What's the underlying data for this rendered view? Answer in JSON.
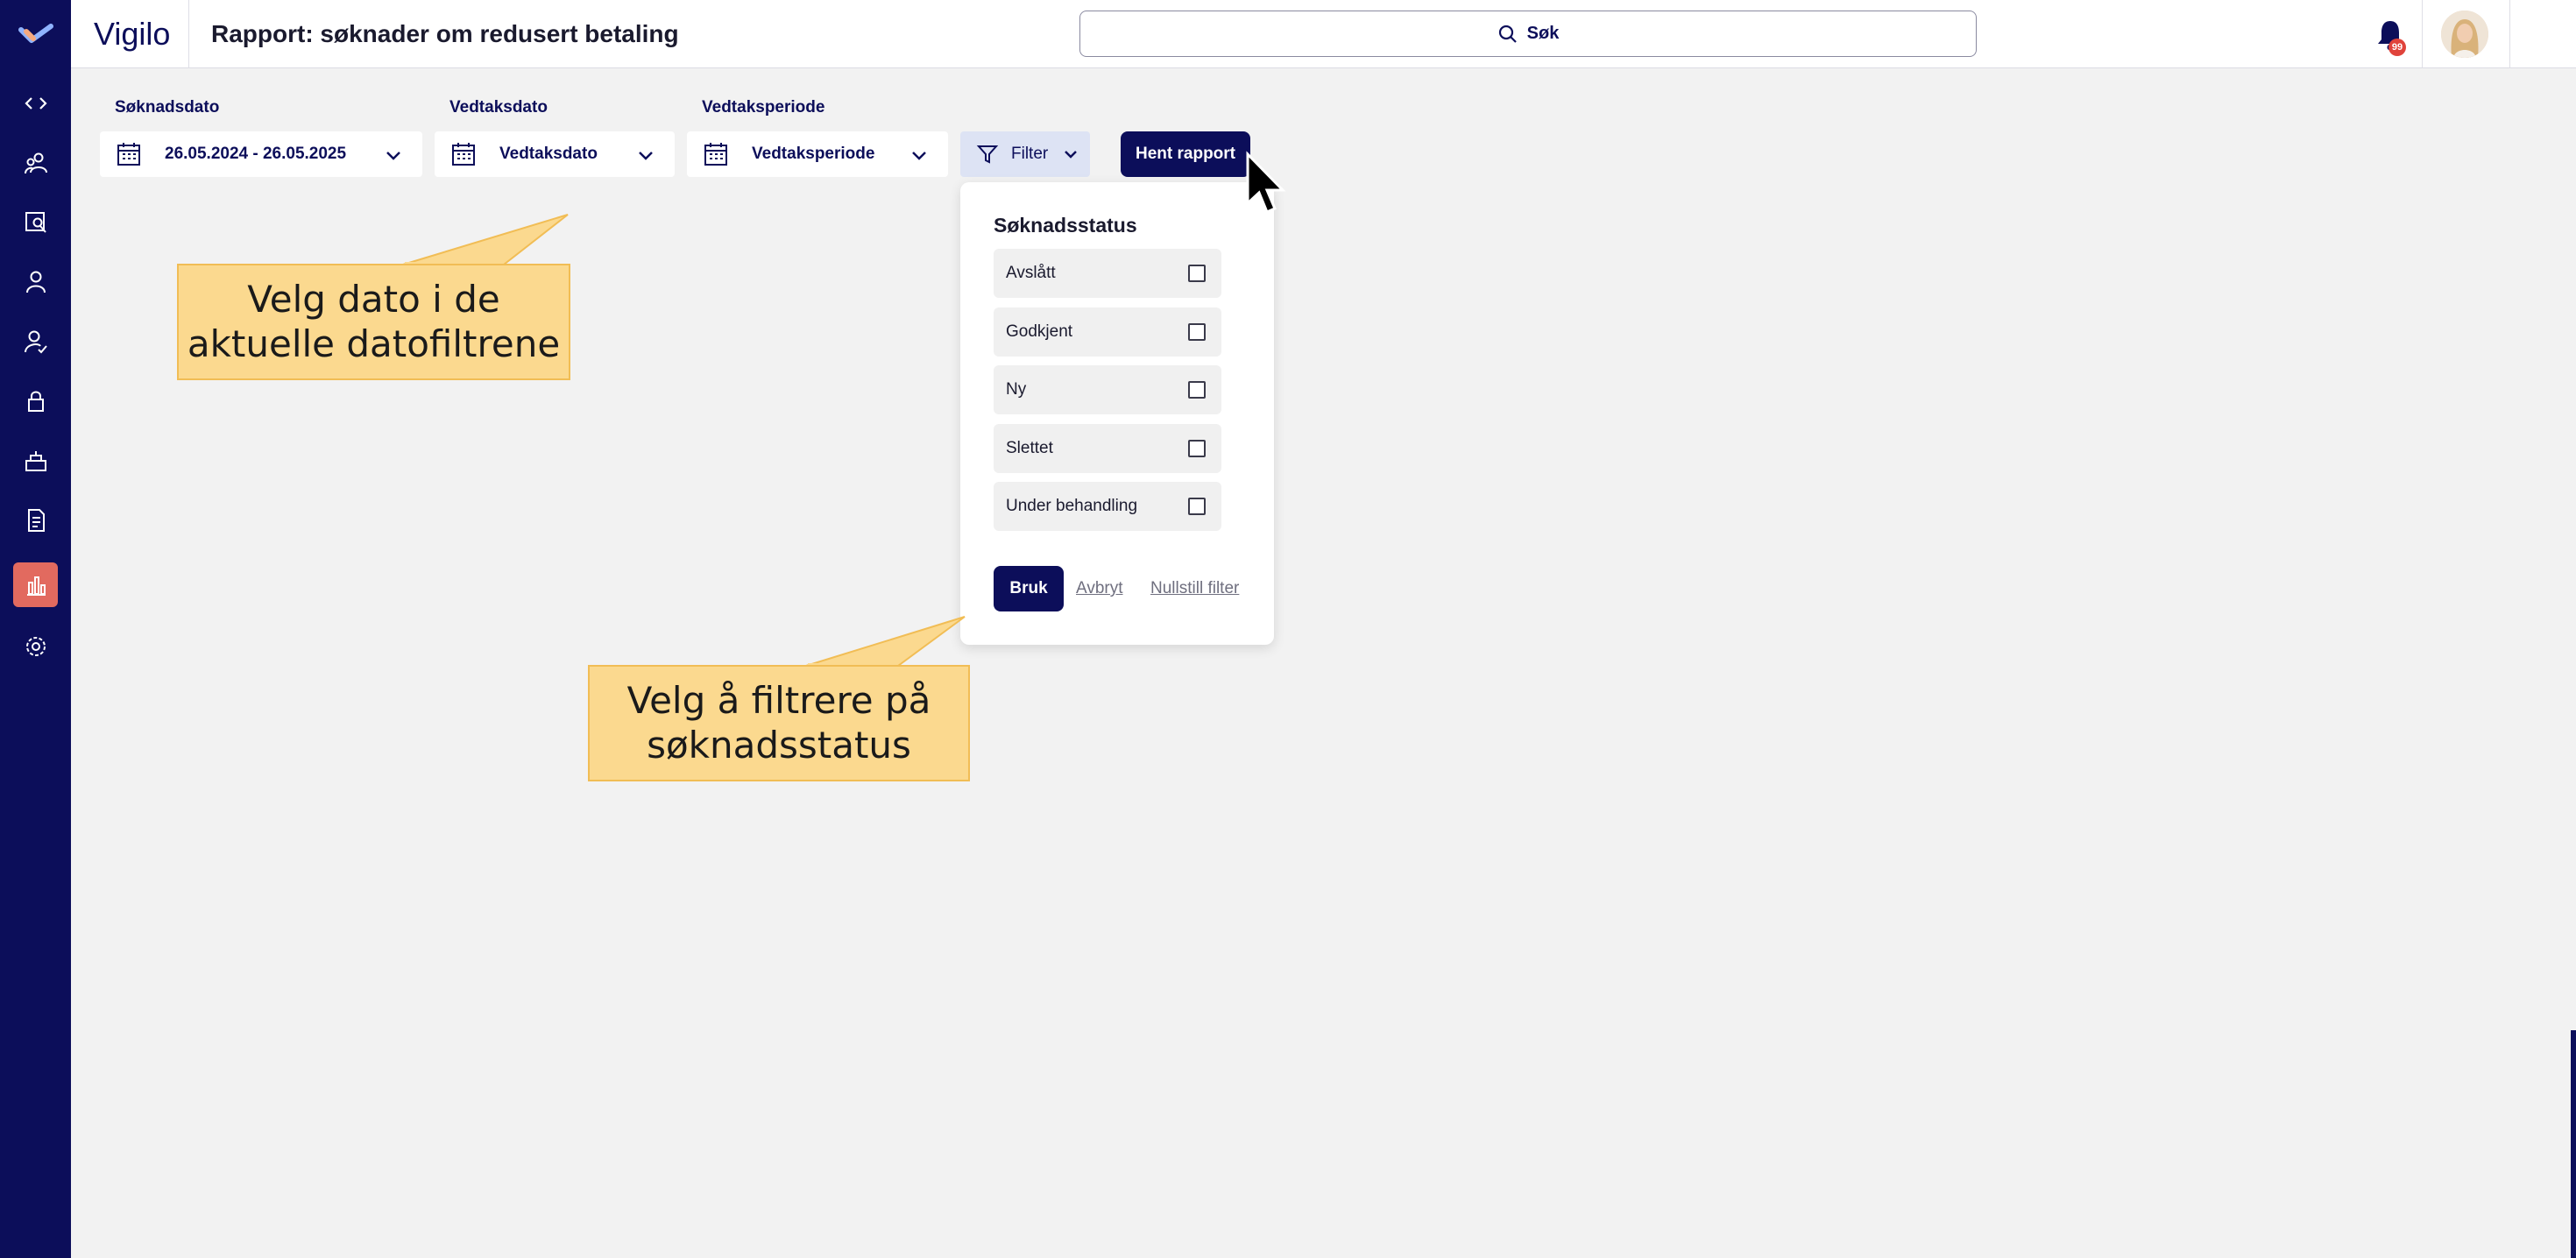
{
  "app": {
    "brand": "Vigilo",
    "title": "Rapport: søknader om redusert betaling"
  },
  "search": {
    "label": "Søk"
  },
  "notifications": {
    "count": "99"
  },
  "sidebar": {
    "items": [
      {
        "icon": "code-icon"
      },
      {
        "icon": "users-icon"
      },
      {
        "icon": "search-person-icon"
      },
      {
        "icon": "person-icon"
      },
      {
        "icon": "person-check-icon"
      },
      {
        "icon": "lock-icon"
      },
      {
        "icon": "cake-icon"
      },
      {
        "icon": "document-icon"
      },
      {
        "icon": "bar-chart-icon",
        "active": true
      },
      {
        "icon": "gear-icon"
      }
    ]
  },
  "filters": {
    "soknadsdato": {
      "label": "Søknadsdato",
      "value": "26.05.2024 - 26.05.2025"
    },
    "vedtaksdato": {
      "label": "Vedtaksdato",
      "value": "Vedtaksdato"
    },
    "vedtaksperiode": {
      "label": "Vedtaksperiode",
      "value": "Vedtaksperiode"
    },
    "filter_button": "Filter",
    "submit": "Hent rapport"
  },
  "status_popover": {
    "title": "Søknadsstatus",
    "options": [
      "Avslått",
      "Godkjent",
      "Ny",
      "Slettet",
      "Under behandling"
    ],
    "apply": "Bruk",
    "cancel": "Avbryt",
    "reset": "Nullstill filter"
  },
  "callouts": {
    "dates": "Velg dato i de aktuelle datofiltrene",
    "status": "Velg å filtrere på søknadsstatus"
  },
  "colors": {
    "navy": "#0c0e5a",
    "accent": "#e26a5f",
    "callout": "#fbd98f"
  }
}
